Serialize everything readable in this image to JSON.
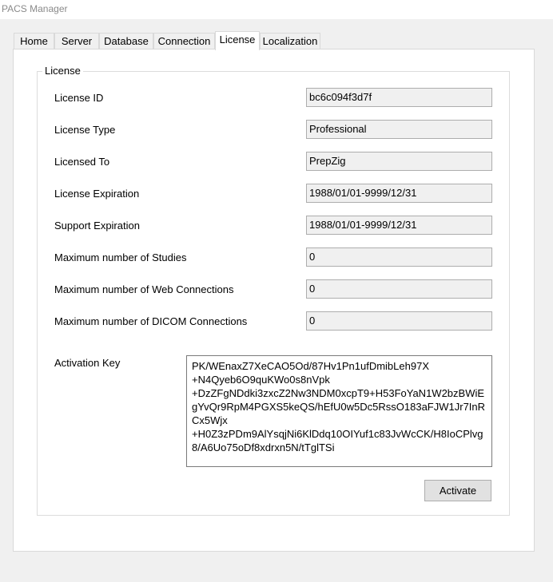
{
  "window": {
    "title": "PACS Manager"
  },
  "tabs": [
    {
      "label": "Home"
    },
    {
      "label": "Server"
    },
    {
      "label": "Database"
    },
    {
      "label": "Connection"
    },
    {
      "label": "License"
    },
    {
      "label": "Localization"
    }
  ],
  "active_tab": "License",
  "license": {
    "group_title": "License",
    "rows": [
      {
        "label": "License ID",
        "value": "bc6c094f3d7f"
      },
      {
        "label": "License Type",
        "value": "Professional"
      },
      {
        "label": "Licensed To",
        "value": "PrepZig"
      },
      {
        "label": "License Expiration",
        "value": "1988/01/01-9999/12/31"
      },
      {
        "label": "Support Expiration",
        "value": "1988/01/01-9999/12/31"
      },
      {
        "label": "Maximum number of Studies",
        "value": "0"
      },
      {
        "label": "Maximum number of Web Connections",
        "value": "0"
      },
      {
        "label": "Maximum number of DICOM Connections",
        "value": "0"
      }
    ],
    "activation_key_label": "Activation Key",
    "activation_key": "PK/WEnaxZ7XeCAO5Od/87Hv1Pn1ufDmibLeh97X\n+N4Qyeb6O9quKWo0s8nVpk\n+DzZFgNDdki3zxcZ2Nw3NDM0xcpT9+H53FoYaN1W2bzBWiEgYvQr9RpM4PGXS5keQS/hEfU0w5Dc5RssO183aFJW1Jr7InRCx5Wjx\n+H0Z3zPDm9AlYsqjNi6KlDdq10OIYuf1c83JvWcCK/H8IoCPlvg8/A6Uo75oDf8xdrxn5N/tTglTSi",
    "activate_label": "Activate"
  }
}
